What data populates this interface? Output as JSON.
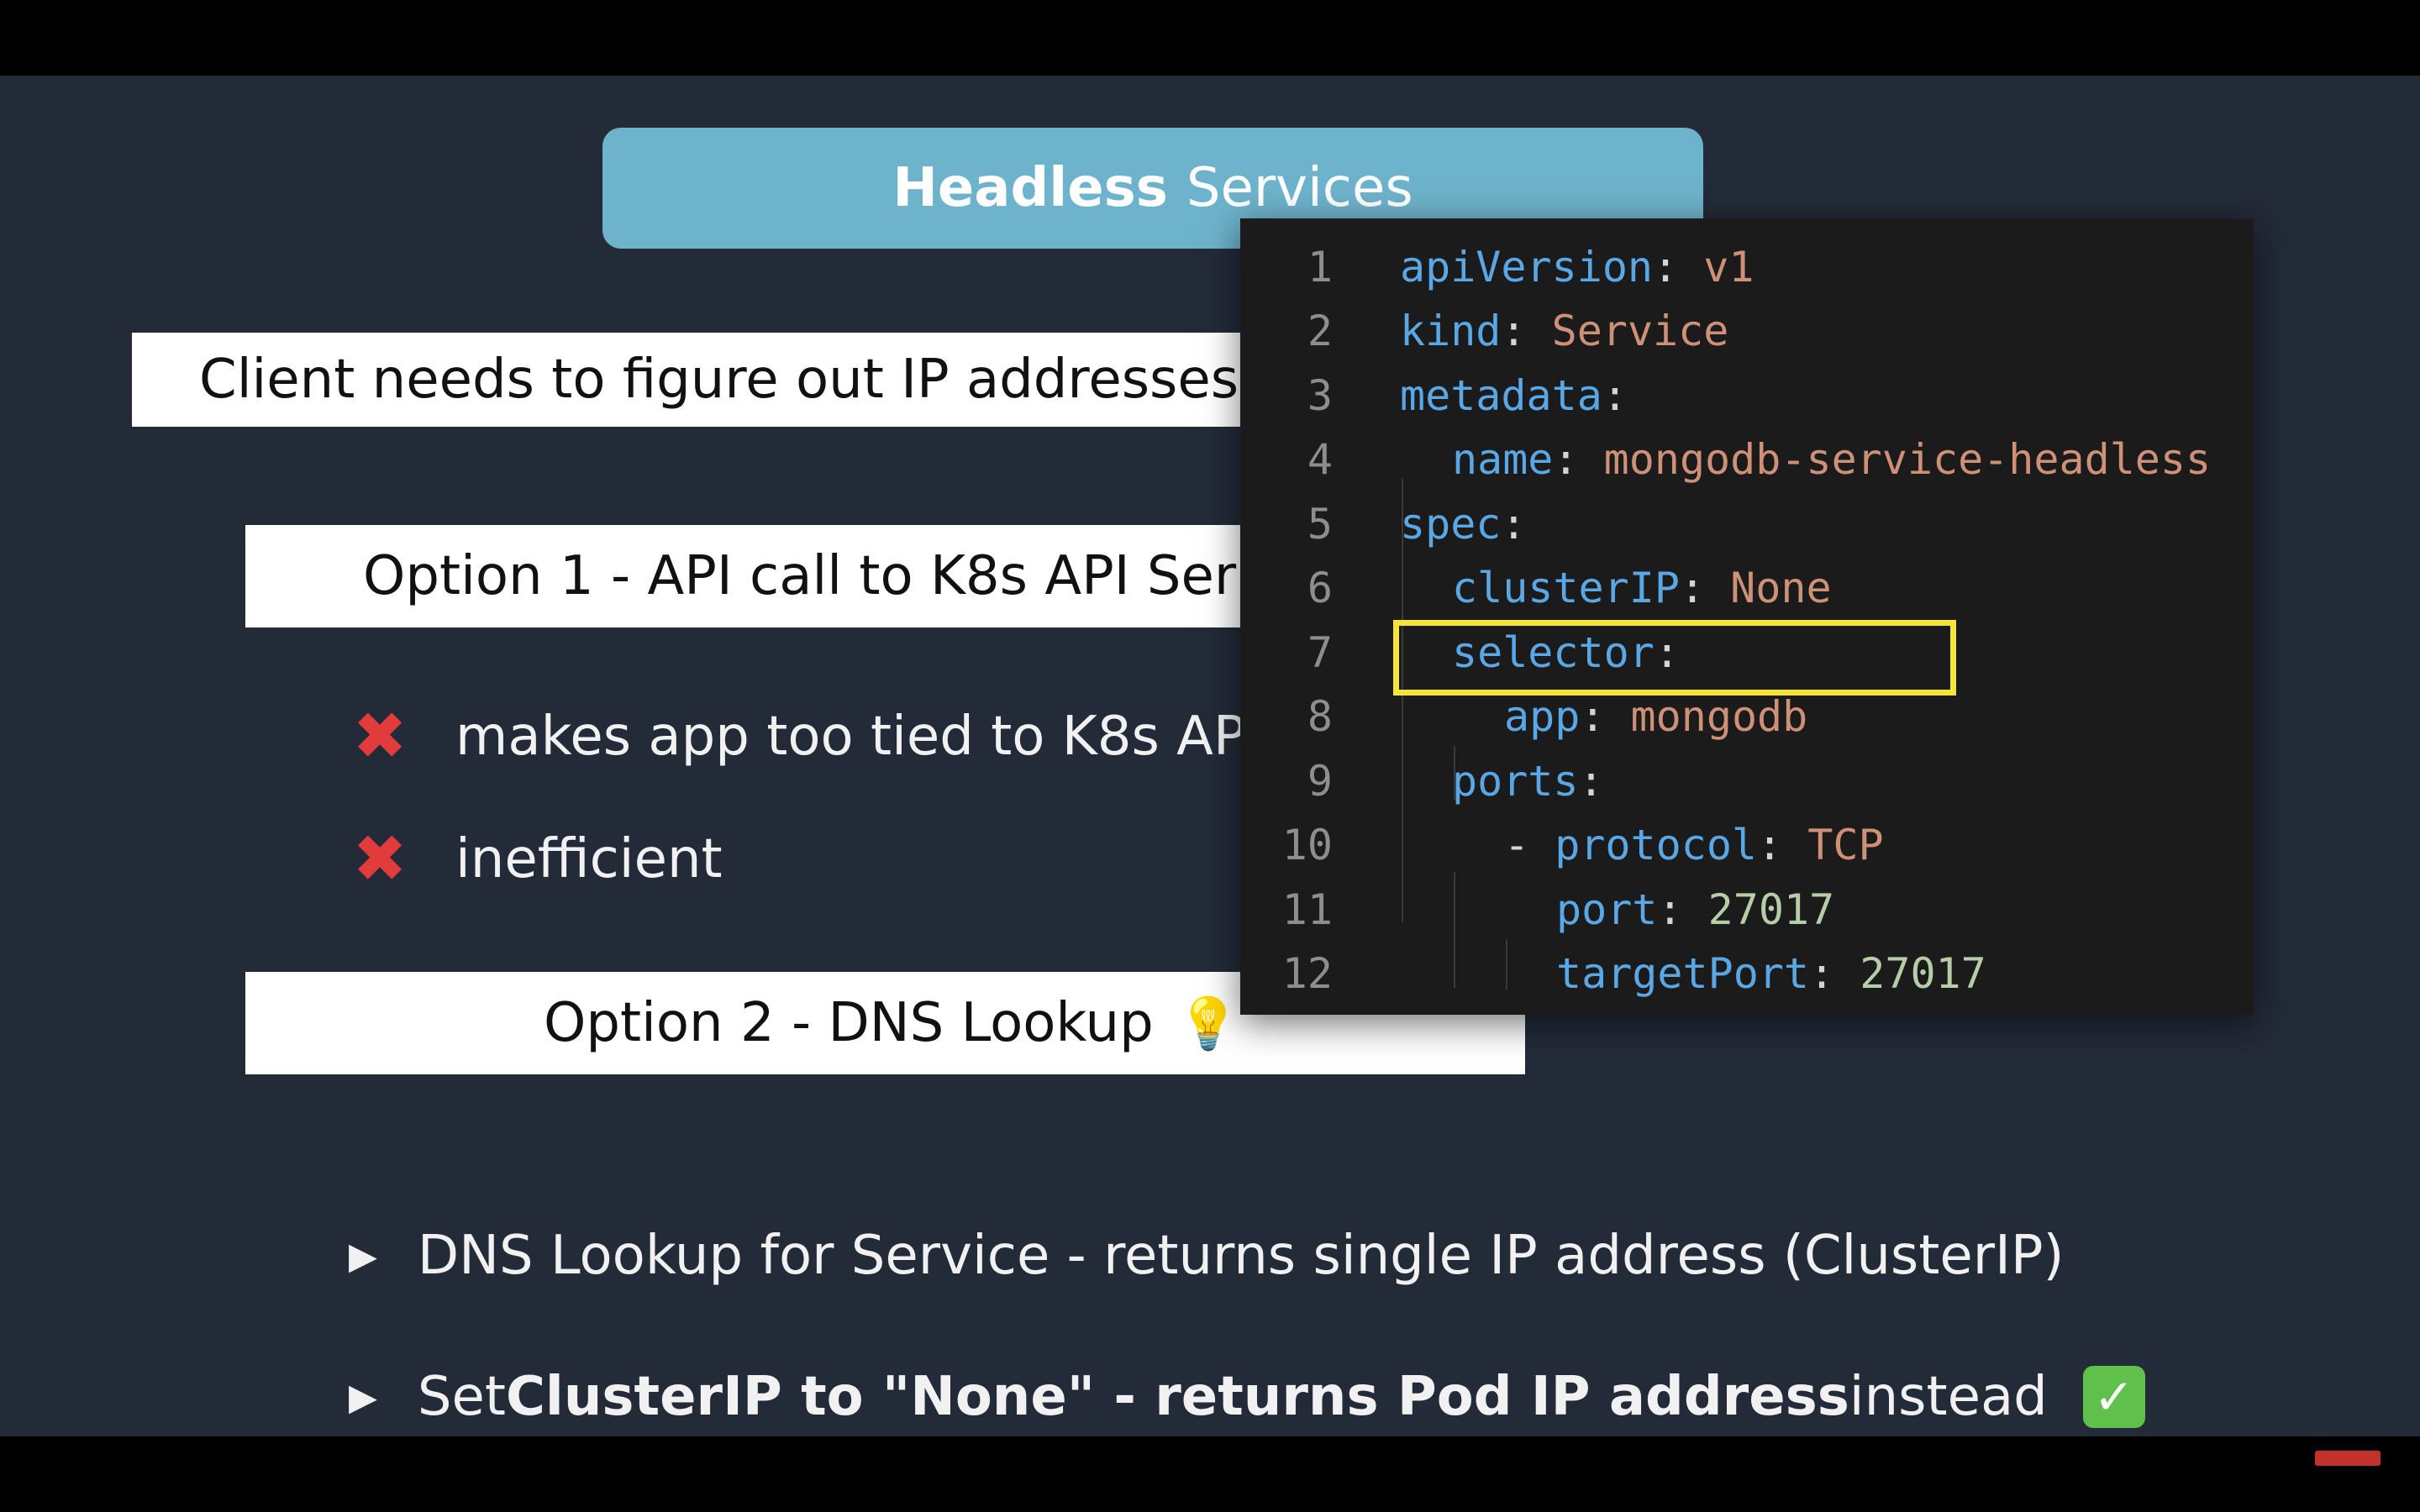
{
  "slide": {
    "title_bold": "Headless",
    "title_rest": "Services",
    "client_text": "Client needs to figure out IP addresses",
    "option1": "Option 1 - API call to K8s API Ser",
    "cons": [
      {
        "icon": "cross-mark-icon",
        "text": "makes app too tied to K8s API"
      },
      {
        "icon": "cross-mark-icon",
        "text": "inefficient"
      }
    ],
    "option2": "Option 2 - DNS Lookup",
    "bullet1": "DNS Lookup for Service - returns single IP address (ClusterIP)",
    "bullet2_pre": "Set ",
    "bullet2_bold": "ClusterIP to \"None\" - returns Pod IP address",
    "bullet2_post": " instead",
    "check_icon": "check-mark-icon"
  },
  "code": {
    "lines": [
      {
        "num": "1",
        "key": "apiVersion",
        "sep": ": ",
        "val": "v1"
      },
      {
        "num": "2",
        "key": "kind",
        "sep": ": ",
        "val": "Service"
      },
      {
        "num": "3",
        "key": "metadata",
        "sep": ":",
        "val": ""
      },
      {
        "num": "4",
        "key": "name",
        "sep": ": ",
        "val": "mongodb-service-headless"
      },
      {
        "num": "5",
        "key": "spec",
        "sep": ":",
        "val": ""
      },
      {
        "num": "6",
        "key": "clusterIP",
        "sep": ": ",
        "val": "None"
      },
      {
        "num": "7",
        "key": "selector",
        "sep": ":",
        "val": ""
      },
      {
        "num": "8",
        "key": "app",
        "sep": ": ",
        "val": "mongodb"
      },
      {
        "num": "9",
        "key": "ports",
        "sep": ":",
        "val": ""
      },
      {
        "num": "10",
        "dash": "- ",
        "key": "protocol",
        "sep": ": ",
        "val": "TCP"
      },
      {
        "num": "11",
        "key": "port",
        "sep": ": ",
        "val": "27017"
      },
      {
        "num": "12",
        "key": "targetPort",
        "sep": ": ",
        "val": "27017"
      }
    ]
  },
  "colors": {
    "slide_bg": "#232a38",
    "title_pill": "#6eb3cc",
    "highlight": "#f5e43a",
    "code_key": "#5aa7e6",
    "code_string": "#ce9178",
    "code_number": "#b5cea8"
  }
}
